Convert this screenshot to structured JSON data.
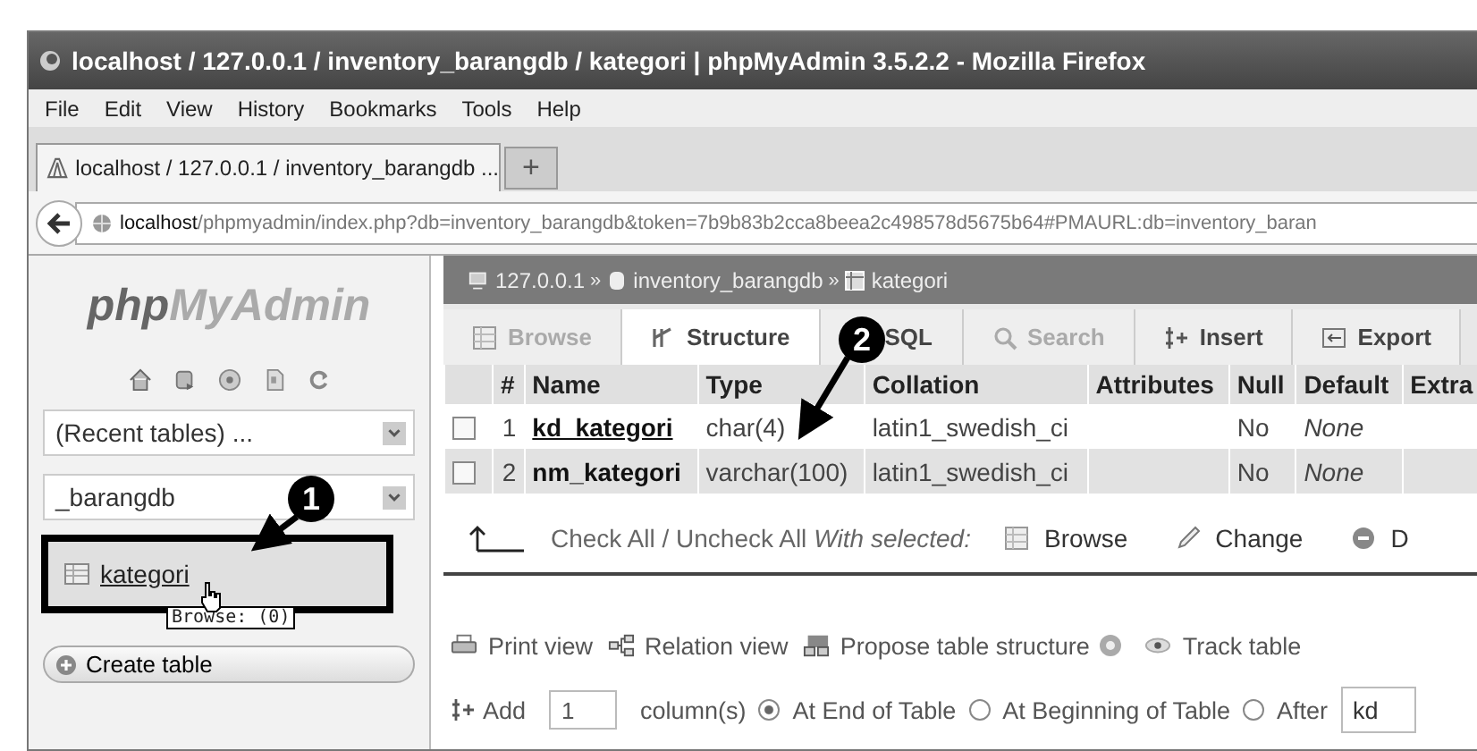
{
  "window": {
    "title": "localhost / 127.0.0.1 / inventory_barangdb / kategori | phpMyAdmin 3.5.2.2 - Mozilla Firefox"
  },
  "menu": [
    "File",
    "Edit",
    "View",
    "History",
    "Bookmarks",
    "Tools",
    "Help"
  ],
  "browser_tabs": [
    {
      "label": "localhost / 127.0.0.1 / inventory_barangdb ...",
      "selected": true
    }
  ],
  "new_tab": "+",
  "address_bar": {
    "host": "localhost",
    "path": "/phpmyadmin/index.php?db=inventory_barangdb&token=7b9b83b2cca8beea2c498578d5675b64#PMAURL:db=inventory_baran"
  },
  "sidebar": {
    "logo": {
      "first": "php",
      "second": "MyAdmin"
    },
    "selects": [
      {
        "value": "(Recent tables) ..."
      },
      {
        "value": "_barangdb"
      }
    ],
    "tables": [
      {
        "name": "kategori",
        "highlighted": true
      }
    ],
    "tooltip": "Browse:  (0)",
    "create_button": "Create table"
  },
  "breadcrumb": {
    "items": [
      {
        "kind": "server",
        "label": "127.0.0.1"
      },
      {
        "kind": "database",
        "label": "inventory_barangdb"
      },
      {
        "kind": "table",
        "label": "kategori"
      }
    ],
    "separator": "»"
  },
  "tabs": [
    {
      "kind": "browse",
      "label": "Browse",
      "selected": false,
      "disabled": true
    },
    {
      "kind": "structure",
      "label": "Structure",
      "selected": true,
      "disabled": false
    },
    {
      "kind": "sql",
      "label": "SQL",
      "selected": false,
      "disabled": false
    },
    {
      "kind": "search",
      "label": "Search",
      "selected": false,
      "disabled": true
    },
    {
      "kind": "insert",
      "label": "Insert",
      "selected": false,
      "disabled": false
    },
    {
      "kind": "export",
      "label": "Export",
      "selected": false,
      "disabled": false
    }
  ],
  "table": {
    "columns": [
      "#",
      "Name",
      "Type",
      "Collation",
      "Attributes",
      "Null",
      "Default",
      "Extra"
    ],
    "rows": [
      {
        "checked": false,
        "num": "1",
        "name": "kd_kategori",
        "primary": true,
        "type": "char(4)",
        "collation": "latin1_swedish_ci",
        "null": "No",
        "default": "None"
      },
      {
        "checked": false,
        "num": "2",
        "name": "nm_kategori",
        "primary": false,
        "type": "varchar(100)",
        "collation": "latin1_swedish_ci",
        "null": "No",
        "default": "None"
      }
    ]
  },
  "bulk": {
    "check_all": "Check All / Uncheck All",
    "with_selected": "With selected:",
    "actions": [
      {
        "kind": "browse",
        "label": "Browse"
      },
      {
        "kind": "change",
        "label": "Change"
      },
      {
        "kind": "drop",
        "label": "D"
      }
    ]
  },
  "links": [
    {
      "kind": "print",
      "label": "Print view"
    },
    {
      "kind": "relation",
      "label": "Relation view"
    },
    {
      "kind": "propose",
      "label": "Propose table structure"
    },
    {
      "kind": "track",
      "label": "Track table"
    }
  ],
  "add_columns": {
    "label": "Add",
    "count": "1",
    "unit": "column(s)",
    "positions": [
      {
        "label": "At End of Table",
        "selected": true
      },
      {
        "label": "At Beginning of Table",
        "selected": false
      },
      {
        "label": "After",
        "selected": false
      }
    ],
    "after_value": "kd"
  },
  "annotations": [
    {
      "label": "1"
    },
    {
      "label": "2"
    }
  ]
}
